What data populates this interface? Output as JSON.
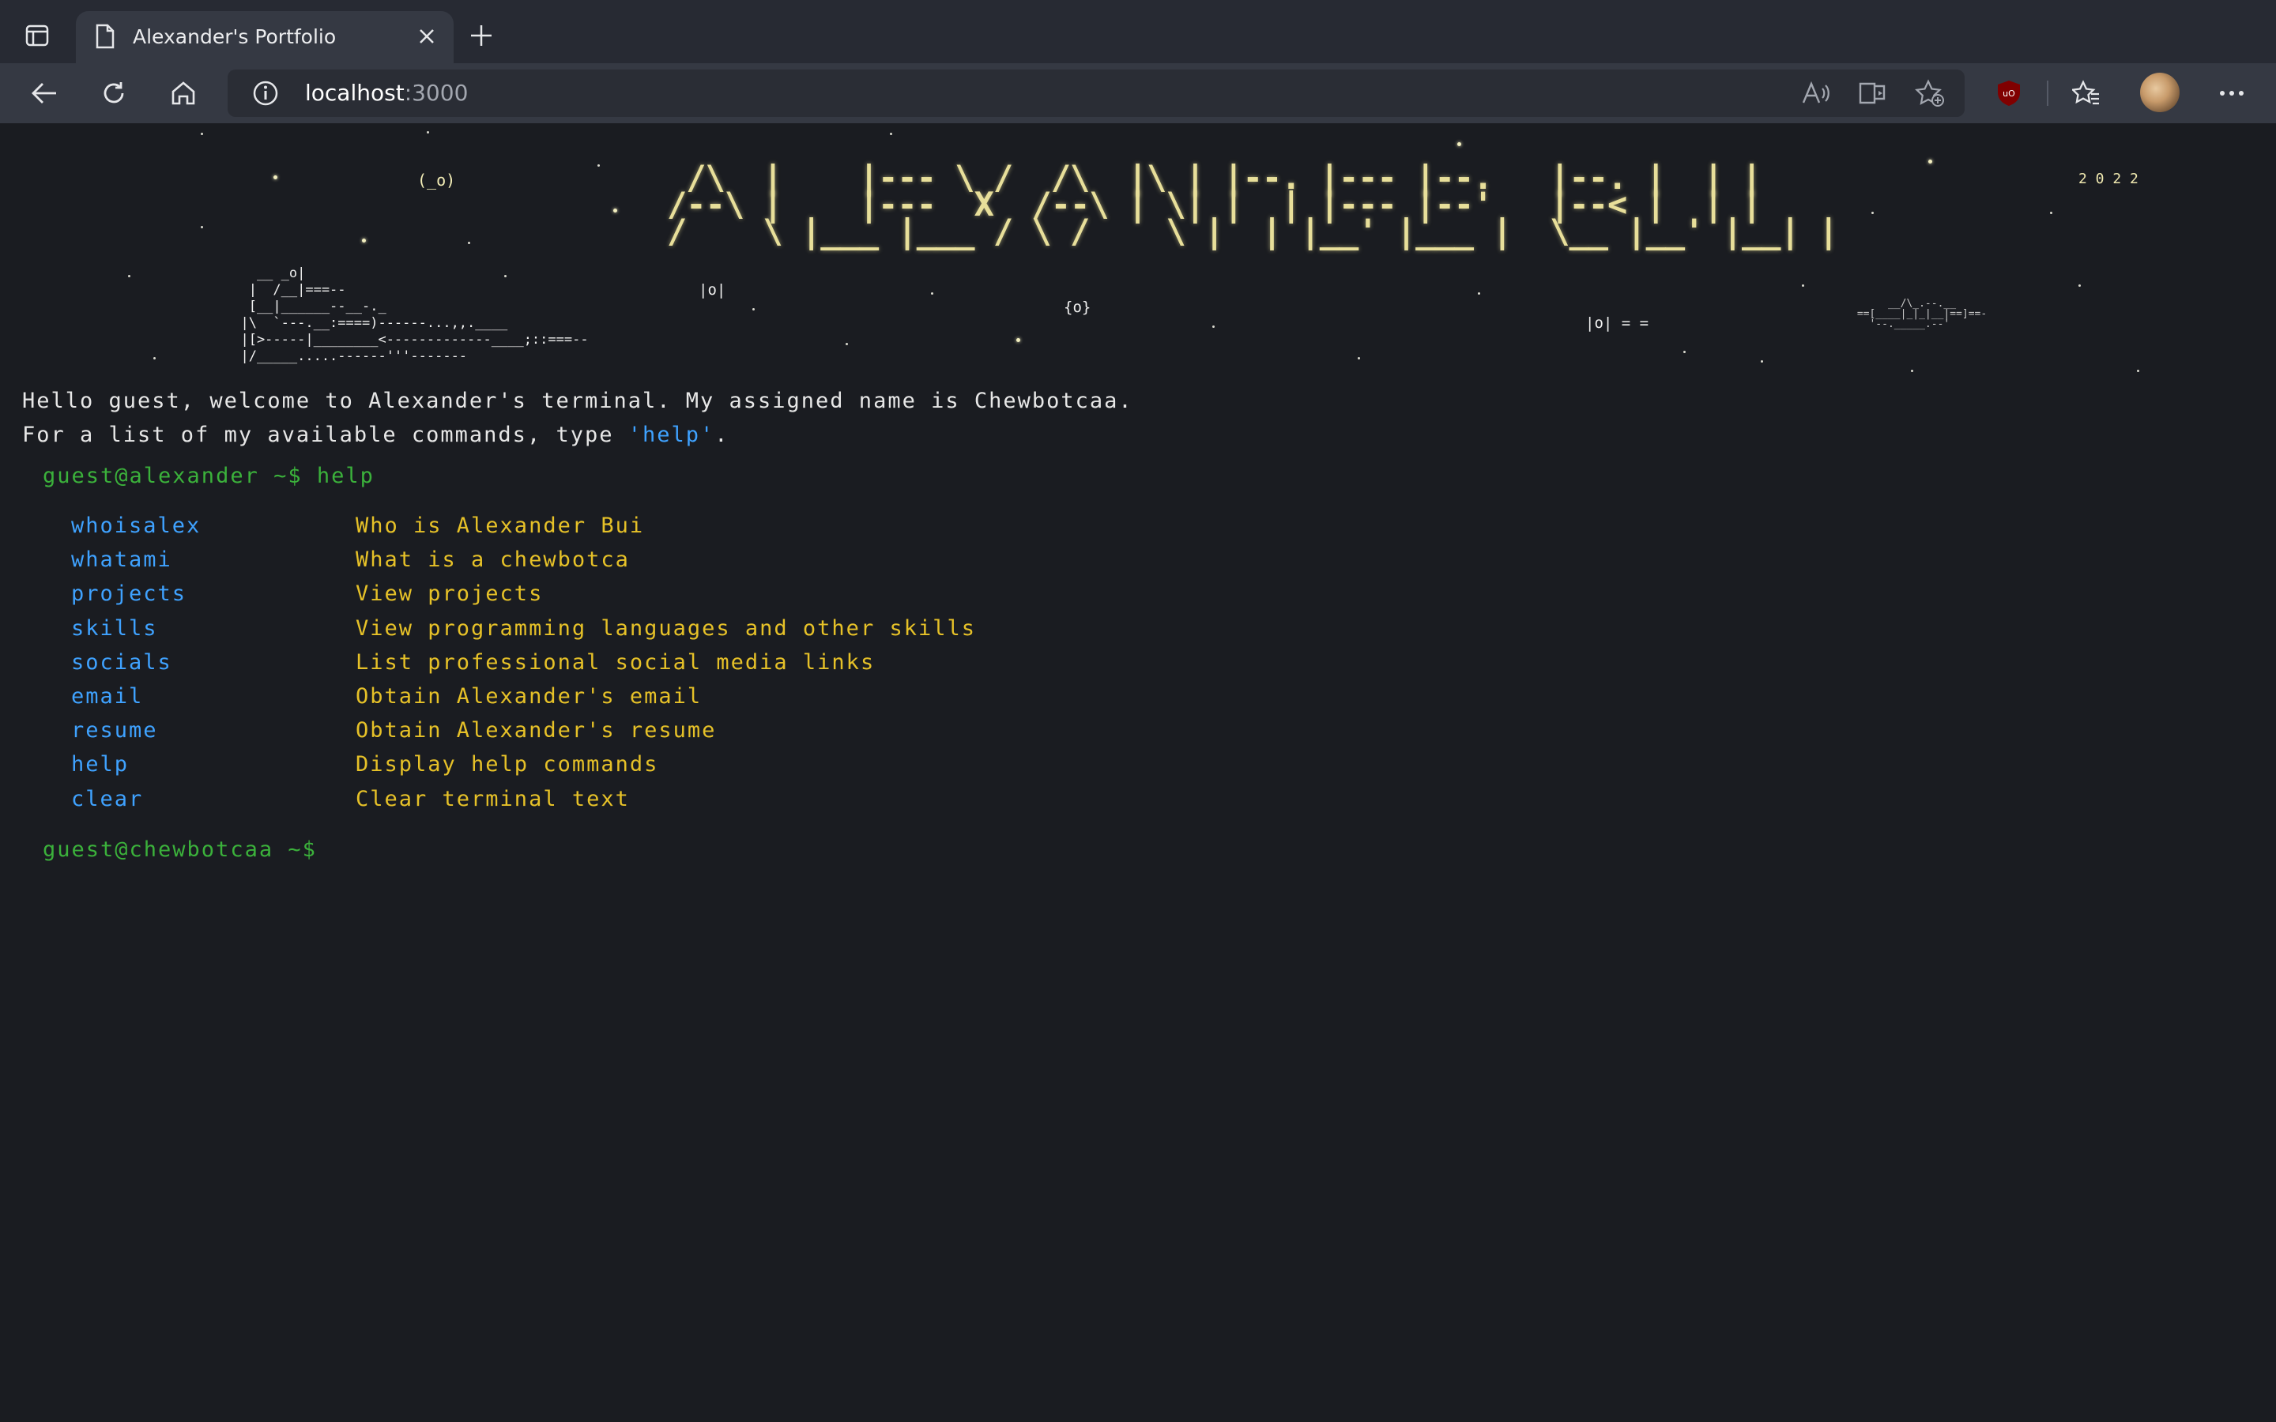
{
  "browser": {
    "tab_title": "Alexander's Portfolio",
    "address_host": "localhost",
    "address_port": ":3000"
  },
  "header": {
    "ascii_title": " /\\  |    |--- \\ /  /\\  |\\ | |--. |--- |--.   |--. |  | |\n/--\\ |    |---  X  /--\\ | \\| |  | |--- |--'   |--< |  | |\n/    \\ |___ |___ / \\ /    \\ |  | |__' |___ |  \\__ |__' |__| |",
    "year": "2 0 2 2",
    "ascii_ship_left": "    __ _o|\n   |  /__|===--\n   [__|______--__-._\n  |\\  `---.__:====)------...,,.____\n  |[>-----|________<-------------____;::===--\n  |/_____.....------'''-------",
    "ascii_ship_right": "      __/\\_.--.__\n ==[____|_|_|__|==]==-\n   '--._____.--'",
    "tie_1": "(_o)",
    "tie_2": "|o|",
    "tie_3": "{o}",
    "tie_4": "|o| = ="
  },
  "terminal": {
    "welcome_line": "Hello guest, welcome to Alexander's terminal. My assigned name is Chewbotcaa.",
    "help_prefix": "For a list of my available commands, type ",
    "help_keyword": "'help'",
    "help_suffix": ".",
    "prompt_1": "guest@alexander ~$ help",
    "commands": [
      {
        "name": "whoisalex",
        "desc": "Who is Alexander Bui"
      },
      {
        "name": "whatami",
        "desc": "What is a chewbotca"
      },
      {
        "name": "projects",
        "desc": "View projects"
      },
      {
        "name": "skills",
        "desc": "View programming languages and other skills"
      },
      {
        "name": "socials",
        "desc": "List professional social media links"
      },
      {
        "name": "email",
        "desc": "Obtain Alexander's email"
      },
      {
        "name": "resume",
        "desc": "Obtain Alexander's resume"
      },
      {
        "name": "help",
        "desc": "Display help commands"
      },
      {
        "name": "clear",
        "desc": "Clear terminal text"
      }
    ],
    "prompt_2": "guest@chewbotcaa ~$"
  }
}
